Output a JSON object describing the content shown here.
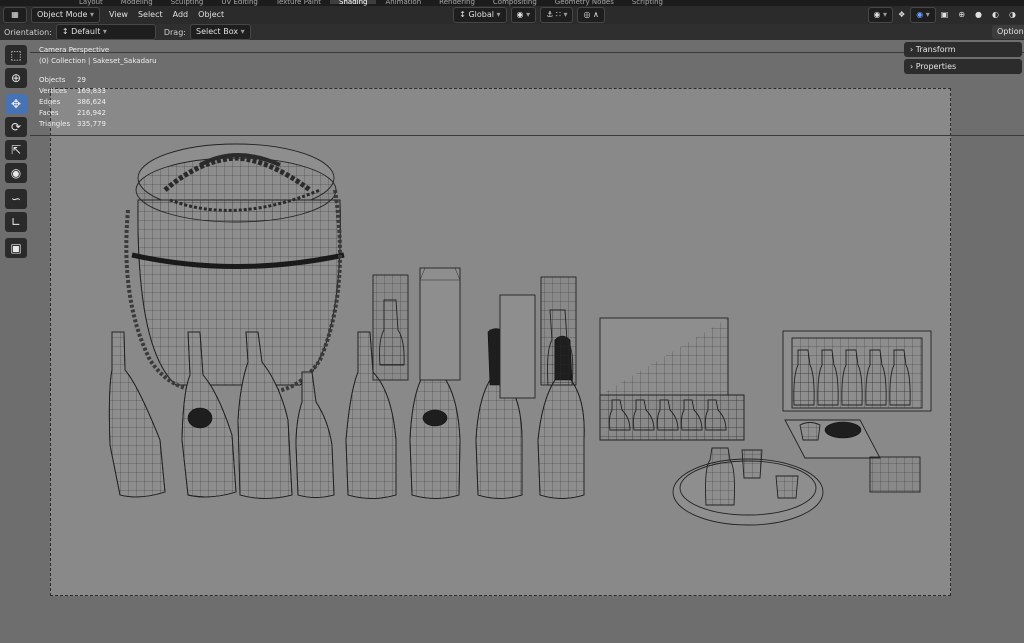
{
  "workspace_tabs": [
    {
      "label": "Layout",
      "active": false
    },
    {
      "label": "Modeling",
      "active": false
    },
    {
      "label": "Sculpting",
      "active": false
    },
    {
      "label": "UV Editing",
      "active": false
    },
    {
      "label": "Texture Paint",
      "active": false
    },
    {
      "label": "Shading",
      "active": true
    },
    {
      "label": "Animation",
      "active": false
    },
    {
      "label": "Rendering",
      "active": false
    },
    {
      "label": "Compositing",
      "active": false
    },
    {
      "label": "Geometry Nodes",
      "active": false
    },
    {
      "label": "Scripting",
      "active": false
    }
  ],
  "header": {
    "mode": "Object Mode",
    "menus": [
      "View",
      "Select",
      "Add",
      "Object"
    ],
    "transform_orientation": "Global"
  },
  "tool_header": {
    "orientation_label": "Orientation:",
    "orientation_value": "Default",
    "drag_label": "Drag:",
    "drag_value": "Select Box",
    "options_label": "Options"
  },
  "viewport": {
    "view_name": "Camera Perspective",
    "collection_info": "(0) Collection | Sakeset_Sakadaru",
    "stats": [
      {
        "label": "Objects",
        "value": "29"
      },
      {
        "label": "Vertices",
        "value": "169,833"
      },
      {
        "label": "Edges",
        "value": "386,624"
      },
      {
        "label": "Faces",
        "value": "216,942"
      },
      {
        "label": "Triangles",
        "value": "335,779"
      }
    ]
  },
  "n_panel": {
    "transform_label": "Transform",
    "properties_label": "Properties"
  },
  "toolbar_tools": [
    "select-box-icon",
    "cursor-icon",
    "move-icon",
    "rotate-icon",
    "scale-icon",
    "transform-icon",
    "annotate-icon",
    "measure-icon",
    "add-cube-icon"
  ],
  "colors": {
    "accent": "#4772b3",
    "header_bg": "#2b2b2b",
    "viewport_bg": "#6e6e6e",
    "camera_frame_bg": "#898989"
  }
}
